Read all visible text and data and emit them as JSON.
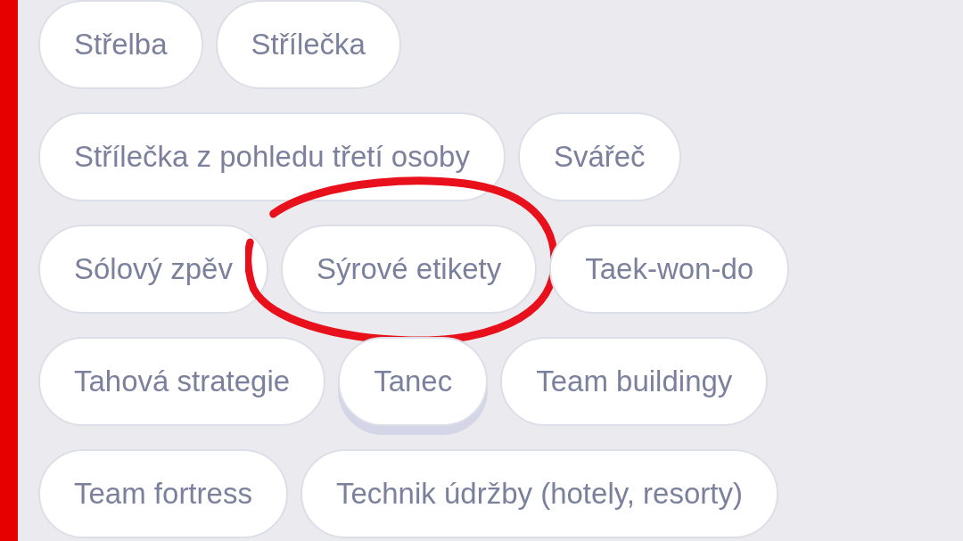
{
  "rows": [
    {
      "chips": [
        {
          "label": "Střelba",
          "pressed": false,
          "highlighted": false
        },
        {
          "label": "Střílečka",
          "pressed": false,
          "highlighted": false
        }
      ]
    },
    {
      "chips": [
        {
          "label": "Střílečka z pohledu třetí osoby",
          "pressed": false,
          "highlighted": false
        },
        {
          "label": "Svářeč",
          "pressed": false,
          "highlighted": false
        }
      ]
    },
    {
      "chips": [
        {
          "label": "Sólový zpěv",
          "pressed": false,
          "highlighted": false
        },
        {
          "label": "Sýrové etikety",
          "pressed": false,
          "highlighted": true
        },
        {
          "label": "Taek-won-do",
          "pressed": false,
          "highlighted": false
        }
      ]
    },
    {
      "chips": [
        {
          "label": "Tahová strategie",
          "pressed": false,
          "highlighted": false
        },
        {
          "label": "Tanec",
          "pressed": true,
          "highlighted": false
        },
        {
          "label": "Team buildingy",
          "pressed": false,
          "highlighted": false
        }
      ]
    },
    {
      "chips": [
        {
          "label": "Team fortress",
          "pressed": false,
          "highlighted": false
        },
        {
          "label": "Technik údržby (hotely, resorty)",
          "pressed": false,
          "highlighted": false
        }
      ]
    }
  ]
}
